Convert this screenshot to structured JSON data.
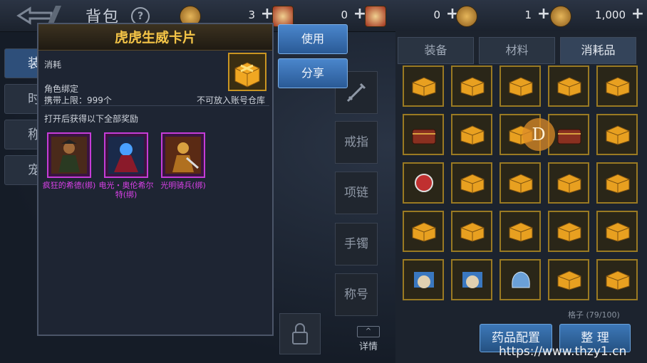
{
  "header": {
    "title": "背包",
    "help": "?",
    "resources": [
      {
        "icon": "gold-coin-icon",
        "value": "3"
      },
      {
        "icon": "red-ticket-icon",
        "value": "0"
      },
      {
        "icon": "red-badge-icon",
        "value": "0"
      },
      {
        "icon": "bronze-coin-icon",
        "value": "1"
      },
      {
        "icon": "gold-ingot-icon",
        "value": "1,000"
      }
    ],
    "plus": "+"
  },
  "left_tabs": [
    "装",
    "时",
    "称",
    "宠"
  ],
  "slots": [
    "戒指",
    "项链",
    "手镯",
    "称号"
  ],
  "detail_label": "详情",
  "detail_arrow": "^",
  "right_panel": {
    "tabs": [
      "装备",
      "材料",
      "消耗品"
    ],
    "active_tab": "消耗品",
    "capacity": "格子 (79/100)",
    "buttons": [
      "药品配置",
      "整 理"
    ],
    "badge": "D"
  },
  "popup": {
    "title": "虎虎生威卡片",
    "type": "消耗",
    "bind": "角色绑定",
    "carry_limit": "携带上限：999个",
    "warehouse_note": "不可放入账号仓库",
    "reward_heading": "打开后获得以下全部奖励",
    "rewards": [
      {
        "label": "疯狂的希德(绑)"
      },
      {
        "label": "电光・奥伦希尔特(绑)"
      },
      {
        "label": "光明骑兵(绑)"
      }
    ]
  },
  "actions": {
    "use": "使用",
    "share": "分享"
  },
  "watermark": "https://www.thzy1.cn",
  "colors": {
    "accent_gold": "#f4c447",
    "reward_purple": "#d941e8",
    "button_blue": "#3d78b8"
  }
}
